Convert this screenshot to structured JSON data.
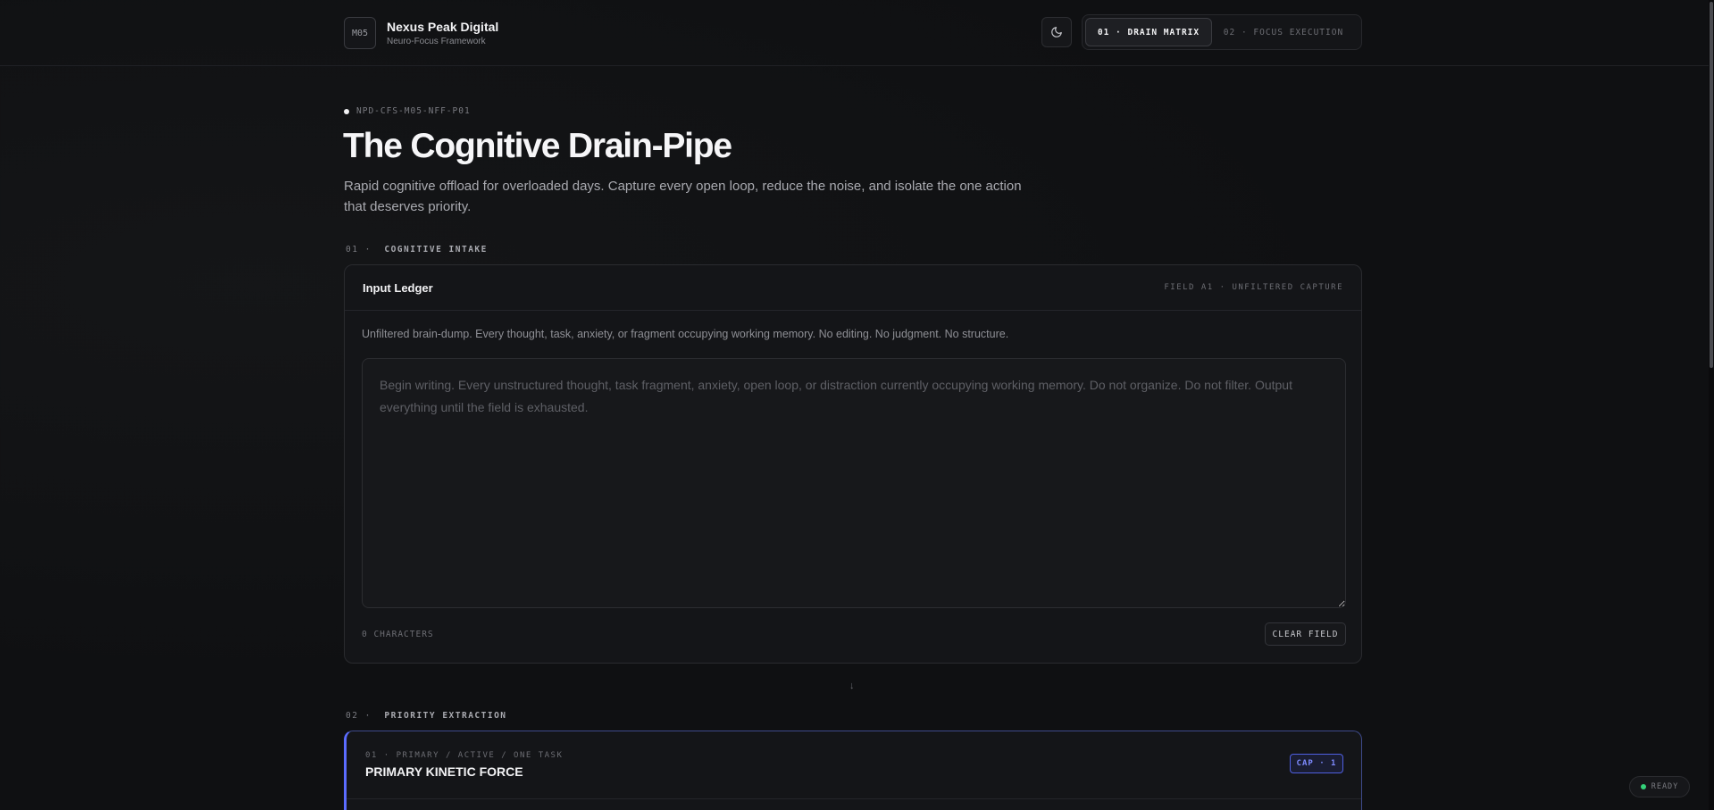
{
  "header": {
    "logo_text": "M05",
    "brand_name": "Nexus Peak Digital",
    "brand_sub": "Neuro-Focus Framework",
    "theme_icon": "moon-icon",
    "tabs": [
      {
        "label": "01 · DRAIN MATRIX",
        "active": true
      },
      {
        "label": "02 · FOCUS EXECUTION",
        "active": false
      }
    ]
  },
  "hero": {
    "doc_id": "NPD-CFS-M05-NFF-P01",
    "title": "The Cognitive Drain-Pipe",
    "description": "Rapid cognitive offload for overloaded days. Capture every open loop, reduce the noise, and isolate the one action that deserves priority."
  },
  "intake": {
    "section_num": "01 ·",
    "section_name": "COGNITIVE INTAKE",
    "card_title": "Input Ledger",
    "card_meta": "FIELD A1 · UNFILTERED CAPTURE",
    "description": "Unfiltered brain-dump. Every thought, task, anxiety, or fragment occupying working memory. No editing. No judgment. No structure.",
    "placeholder": "Begin writing. Every unstructured thought, task fragment, anxiety, open loop, or distraction currently occupying working memory. Do not organize. Do not filter. Output everything until the field is exhausted.",
    "value": "",
    "char_count": "0 CHARACTERS",
    "clear_label": "CLEAR FIELD"
  },
  "flow_arrow": "↓",
  "priority": {
    "section_num": "02 ·",
    "section_name": "PRIORITY EXTRACTION",
    "meta": "01 · PRIMARY / ACTIVE / ONE TASK",
    "title": "PRIMARY KINETIC FORCE",
    "badge": "CAP · 1"
  },
  "status": {
    "label": "READY",
    "color": "#34d27a"
  },
  "colors": {
    "background": "#0f1012",
    "accent": "#5b6cff"
  }
}
